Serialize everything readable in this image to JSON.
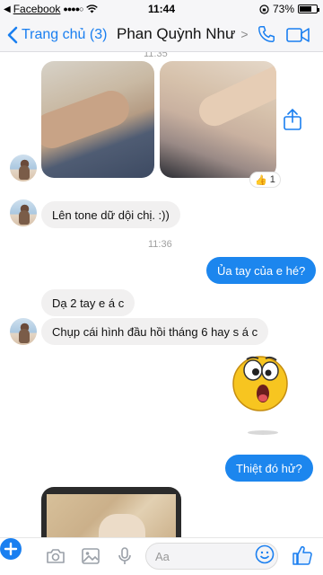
{
  "status_bar": {
    "carrier": "Facebook",
    "signal": "●●●●○",
    "time": "11:44",
    "battery": "73%",
    "battery_level": 0.73
  },
  "header": {
    "back_label": "Trang chủ (3)",
    "contact_name": "Phan Quỳnh Như"
  },
  "messages": {
    "top_timestamp": "11:35",
    "reaction": {
      "emoji": "👍",
      "count": "1"
    },
    "msg1": "Lên tone dữ dội chị. :))",
    "timestamp2": "11:36",
    "msg2": "Ủa tay của e hé?",
    "msg3": "Dạ 2 tay e á c",
    "msg4": "Chụp cái hình đầu hồi tháng 6 hay s á c",
    "msg5": "Thiệt đó hử?"
  },
  "composer": {
    "placeholder": "Aa"
  },
  "colors": {
    "accent": "#1a7ff0",
    "outgoing_bubble": "#1c86ee",
    "incoming_bubble": "#f1f0f0"
  }
}
